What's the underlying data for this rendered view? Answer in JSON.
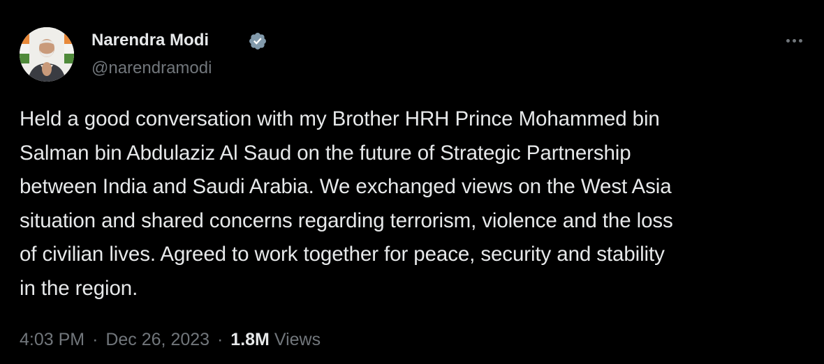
{
  "author": {
    "name": "Narendra Modi",
    "handle": "@narendramodi",
    "verified": true,
    "verified_color": "#829aab"
  },
  "tweet": {
    "lines": [
      "Held a good conversation with my Brother HRH Prince Mohammed bin",
      "Salman bin Abdulaziz Al Saud on the future of Strategic Partnership",
      "between India and Saudi Arabia. We exchanged views on the West Asia",
      "situation and shared concerns regarding terrorism, violence and the loss",
      "of civilian lives. Agreed to work together for peace, security and stability",
      "in the region."
    ]
  },
  "meta": {
    "time": "4:03 PM",
    "separator": "·",
    "date": "Dec 26, 2023",
    "views_count": "1.8M",
    "views_label": "Views"
  },
  "icons": {
    "more": "more-horizontal-icon",
    "verified": "verified-badge-icon"
  },
  "colors": {
    "background": "#000000",
    "primary_text": "#e7e9ea",
    "secondary_text": "#71767b"
  }
}
